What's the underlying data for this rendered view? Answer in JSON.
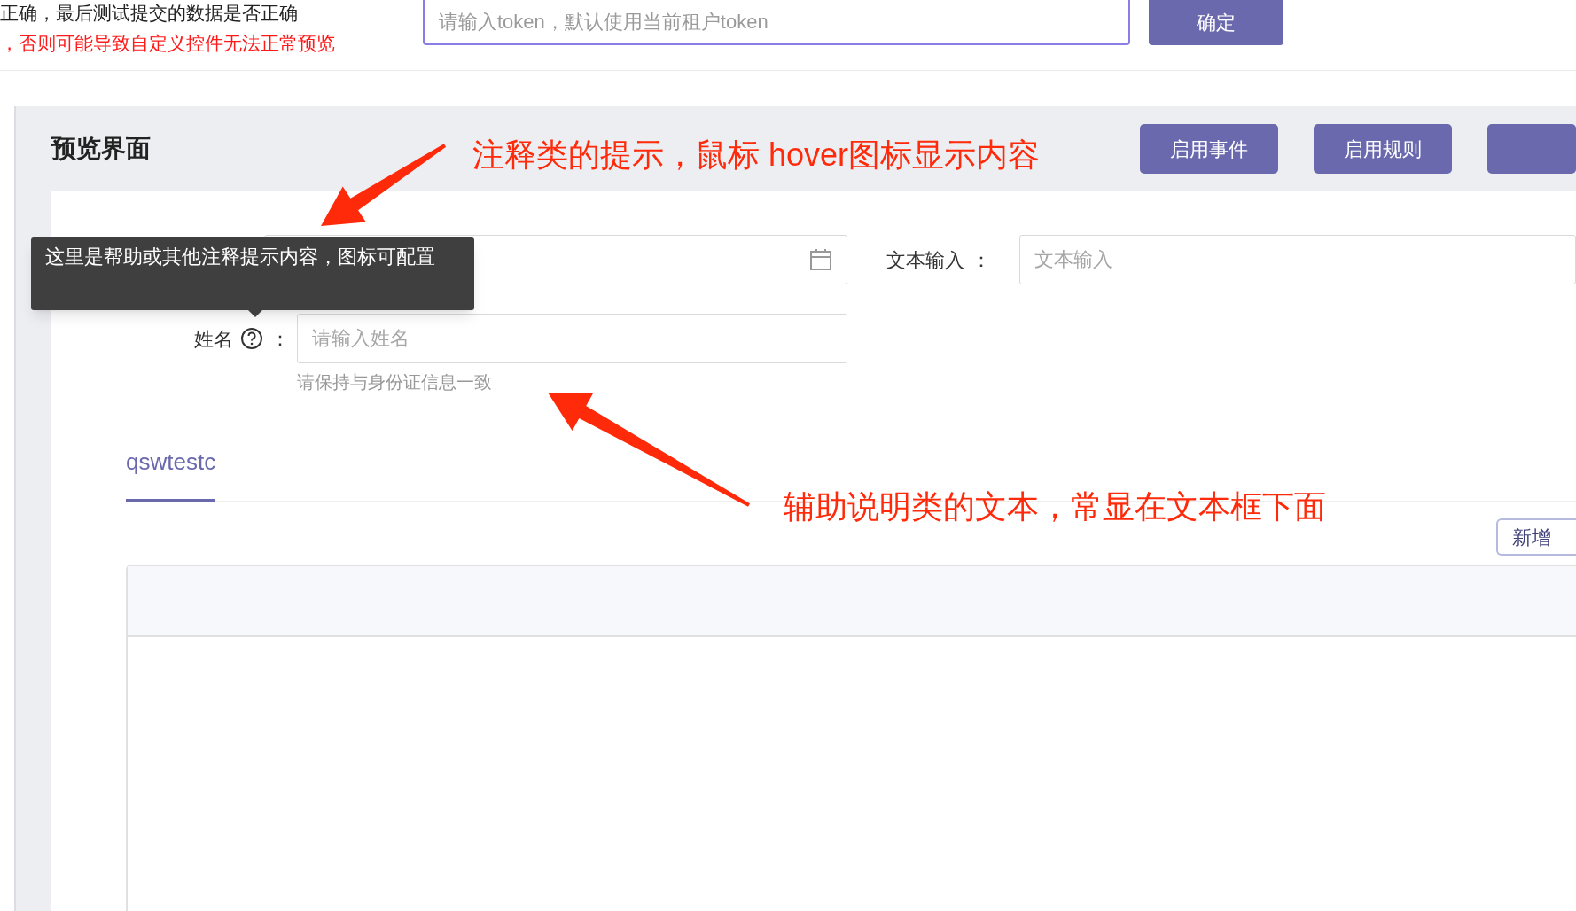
{
  "notice_lines": [
    {
      "text": "正确，最后测试提交的数据是否正确",
      "kind": "normal"
    },
    {
      "text": "，否则可能导致自定义控件无法正常预览",
      "kind": "warning"
    }
  ],
  "token_input": {
    "placeholder": "请输入token，默认使用当前租户token"
  },
  "confirm_button": "确定",
  "preview": {
    "title": "预览界面",
    "buttons": [
      "启用事件",
      "启用规则"
    ],
    "fields": [
      {
        "kind": "date"
      },
      {
        "kind": "text",
        "label": "文本输入",
        "colon": "：",
        "placeholder": "文本输入"
      },
      {
        "kind": "text",
        "label": "姓名",
        "colon": "：",
        "help_icon": true,
        "placeholder": "请输入姓名",
        "hint": "请保持与身份证信息一致"
      }
    ],
    "tooltip": "这里是帮助或其他注释提示内容，图标可配置",
    "tabs": [
      {
        "label": "qswtestc",
        "selected": true
      }
    ],
    "add_row_button": "新增"
  },
  "annotations": [
    "注释类的提示，鼠标 hover图标显示内容",
    "辅助说明类的文本，常显在文本框下面"
  ]
}
